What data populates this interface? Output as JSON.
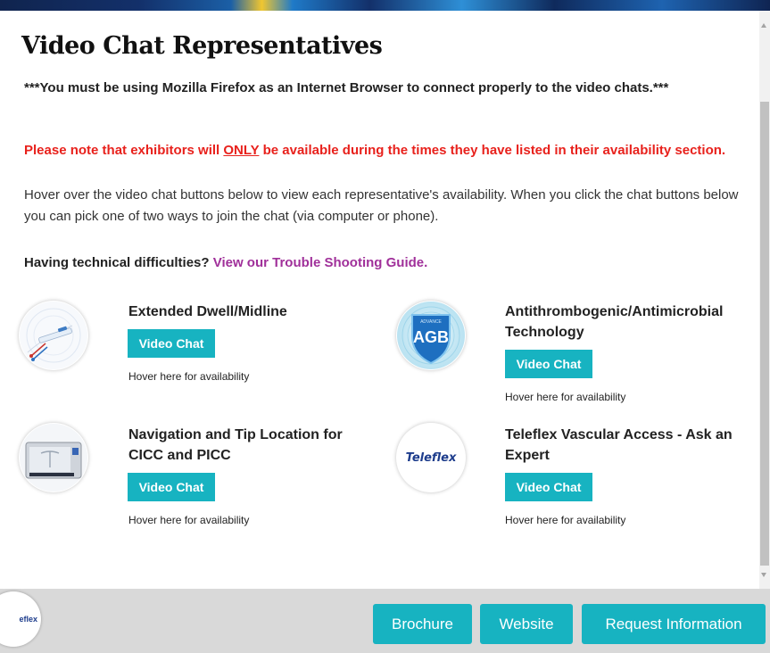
{
  "page": {
    "title": "Video Chat Representatives",
    "firefox_note": "***You must be using Mozilla Firefox as an Internet Browser to connect properly to the video chats.***",
    "note_before": "Please note that exhibitors will ",
    "note_emph": "ONLY",
    "note_after": " be available during the times they have listed in their availability section.",
    "hover_text": "Hover over the video chat buttons below to view each representative's availability. When you click the chat buttons below you can pick one of two ways to join the chat (via computer or phone).",
    "tech_prefix": "Having technical difficulties? ",
    "tech_link": "View our Trouble Shooting Guide."
  },
  "reps": [
    {
      "title": "Extended Dwell/Midline",
      "button": "Video Chat",
      "availability": "Hover here for availability",
      "image": "catheter-device-icon"
    },
    {
      "title": "Antithrombogenic/Antimicrobial Technology",
      "button": "Video Chat",
      "availability": "Hover here for availability",
      "image": "agb-shield-logo",
      "badge_text": "AGB",
      "badge_small": "ADVANCE"
    },
    {
      "title": "Navigation and Tip Location for CICC and PICC",
      "button": "Video Chat",
      "availability": "Hover here for availability",
      "image": "navigation-monitor-icon"
    },
    {
      "title": "Teleflex Vascular Access - Ask an Expert",
      "button": "Video Chat",
      "availability": "Hover here for availability",
      "image": "teleflex-logo",
      "logo_text": "Teleflex"
    }
  ],
  "footer": {
    "logo_text": "eflex",
    "brochure": "Brochure",
    "website": "Website",
    "request": "Request Information"
  },
  "colors": {
    "accent": "#17b3c1",
    "warning": "#e8211c",
    "link": "#a0309a"
  }
}
